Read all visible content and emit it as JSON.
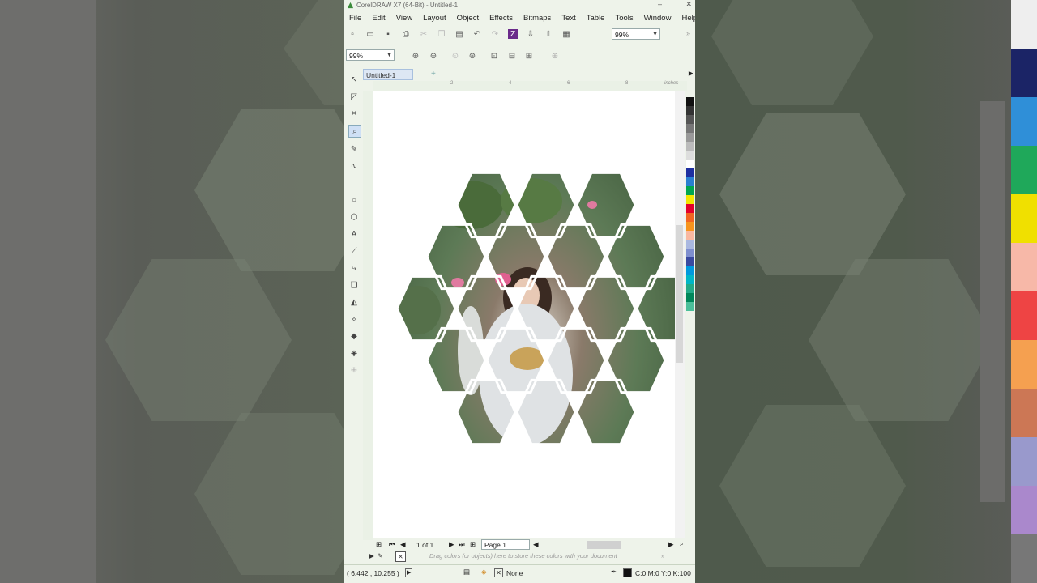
{
  "window": {
    "title": "CorelDRAW X7 (64-Bit) - Untitled-1",
    "controls": [
      "–",
      "□",
      "✕"
    ]
  },
  "menu": [
    "File",
    "Edit",
    "View",
    "Layout",
    "Object",
    "Effects",
    "Bitmaps",
    "Text",
    "Table",
    "Tools",
    "Window",
    "Help"
  ],
  "toolbar": {
    "zoom_value": "99%",
    "zoom_value_2": "99%"
  },
  "document": {
    "tab_label": "Untitled-1",
    "ruler_units": "inches",
    "ruler_numbers": [
      "2",
      "4",
      "6",
      "8"
    ]
  },
  "page_nav": {
    "count": "1 of 1",
    "page_tab": "Page 1"
  },
  "color_hint": "Drag colors (or objects) here to store these colors with your document",
  "status": {
    "coordinates": "( 6.442 , 10.255 )",
    "fill": "None",
    "outline_color": "C:0 M:0 Y:0 K:100"
  },
  "colors": {
    "app_bg": "#eef3ea",
    "hex_fill_light": "#6f9167",
    "hex_fill_dark": "#3e5a3a",
    "tab_bg": "#dde7f4"
  },
  "palette": [
    "#111111",
    "#333333",
    "#555555",
    "#777777",
    "#999999",
    "#bbbbbb",
    "#dddddd",
    "#ffffff",
    "#1e2fa0",
    "#2a7fd0",
    "#00a650",
    "#f2e600",
    "#e4002b",
    "#f26522",
    "#f7941d",
    "#f9b8a0",
    "#aab8e0",
    "#7f8fcf",
    "#3a4aa0",
    "#0099dd",
    "#00b6c6",
    "#22aa88",
    "#00875a",
    "#4bbf9a"
  ],
  "right_palette": [
    "#eeeeee",
    "#1b2466",
    "#2f8fd8",
    "#1fa85a",
    "#f0e000",
    "#f7b8a8",
    "#e44",
    "#f5a050",
    "#cc7755",
    "#9999cc",
    "#aa88cc",
    "#777777"
  ]
}
